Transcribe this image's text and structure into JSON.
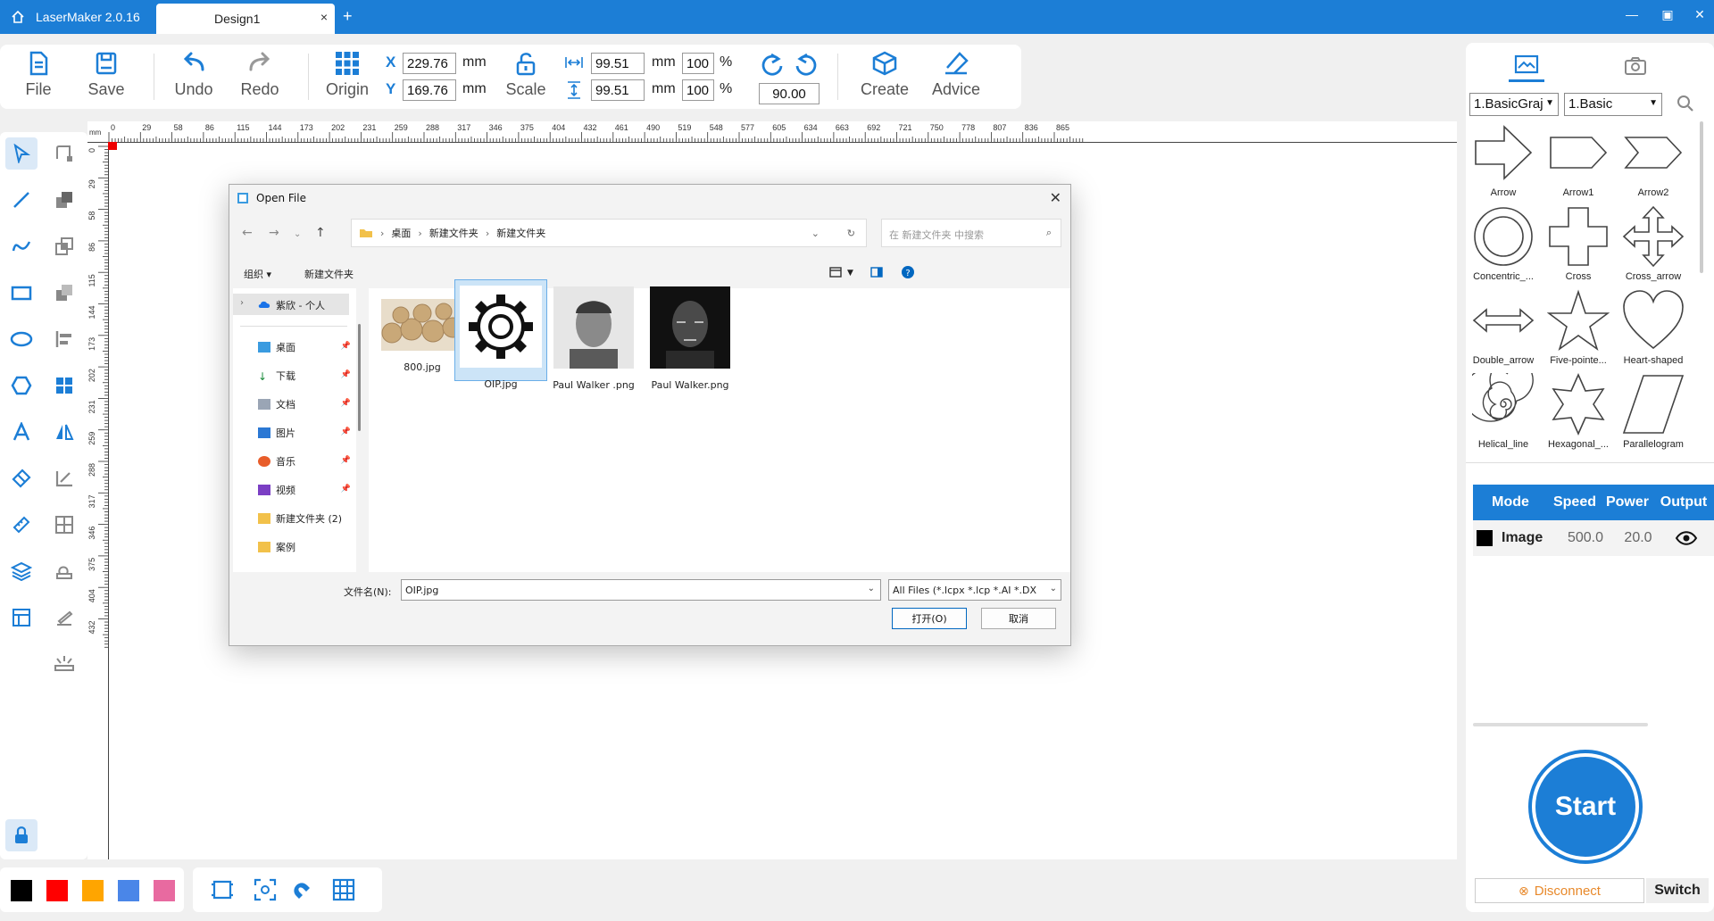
{
  "titlebar": {
    "app_name": "LaserMaker 2.0.16",
    "tab_name": "Design1",
    "tab_close": "×",
    "new_tab": "+"
  },
  "toolbar": {
    "file": "File",
    "save": "Save",
    "undo": "Undo",
    "redo": "Redo",
    "origin": "Origin",
    "scale": "Scale",
    "create": "Create",
    "advice": "Advice",
    "x_label": "X",
    "y_label": "Y",
    "x_value": "229.76",
    "y_value": "169.76",
    "unit_mm": "mm",
    "width_value": "99.51",
    "height_value": "99.51",
    "width_pct": "100",
    "height_pct": "100",
    "pct": "%",
    "rotate_value": "90.00"
  },
  "ruler": {
    "unit": "mm",
    "h_ticks": [
      "0",
      "29",
      "58",
      "86",
      "115",
      "144",
      "173",
      "202",
      "231",
      "259",
      "288",
      "317",
      "346",
      "375",
      "404",
      "432",
      "461",
      "490",
      "519",
      "548",
      "577",
      "605",
      "634",
      "663",
      "692",
      "721",
      "750",
      "778",
      "807",
      "836",
      "865"
    ],
    "v_ticks": [
      "0",
      "29",
      "58",
      "86",
      "115",
      "144",
      "173",
      "202",
      "231",
      "259",
      "288",
      "317",
      "346",
      "375",
      "404",
      "432"
    ]
  },
  "colors": {
    "accent": "#1c7ed6",
    "swatches": [
      "#000000",
      "#ff0000",
      "#ffa500",
      "#4a86e8",
      "#e86aa0"
    ]
  },
  "right_panel": {
    "category_select": "1.BasicGraj",
    "subcategory_select": "1.Basic",
    "shapes": [
      "Arrow",
      "Arrow1",
      "Arrow2",
      "Concentric_...",
      "Cross",
      "Cross_arrow",
      "Double_arrow",
      "Five-pointe...",
      "Heart-shaped",
      "Helical_line",
      "Hexagonal_...",
      "Parallelogram"
    ],
    "layer_headers": [
      "Mode",
      "Speed",
      "Power",
      "Output"
    ],
    "layer_row": {
      "mode": "Image",
      "speed": "500.0",
      "power": "20.0"
    },
    "start": "Start",
    "disconnect": "Disconnect",
    "switch": "Switch"
  },
  "dialog": {
    "title": "Open File",
    "breadcrumb": [
      "桌面",
      "新建文件夹",
      "新建文件夹"
    ],
    "search_placeholder": "在 新建文件夹 中搜索",
    "organize": "组织",
    "new_folder": "新建文件夹",
    "onedrive": "紫欣 - 个人",
    "nav_items": [
      "桌面",
      "下载",
      "文档",
      "图片",
      "音乐",
      "视频",
      "新建文件夹 (2)",
      "案例"
    ],
    "files": [
      "800.jpg",
      "OIP.jpg",
      "Paul Walker .png",
      "Paul Walker.png"
    ],
    "filename_label": "文件名(N):",
    "filename_value": "OIP.jpg",
    "filter": "All Files (*.lcpx *.lcp *.AI *.DX",
    "open_button": "打开(O)",
    "cancel_button": "取消"
  }
}
